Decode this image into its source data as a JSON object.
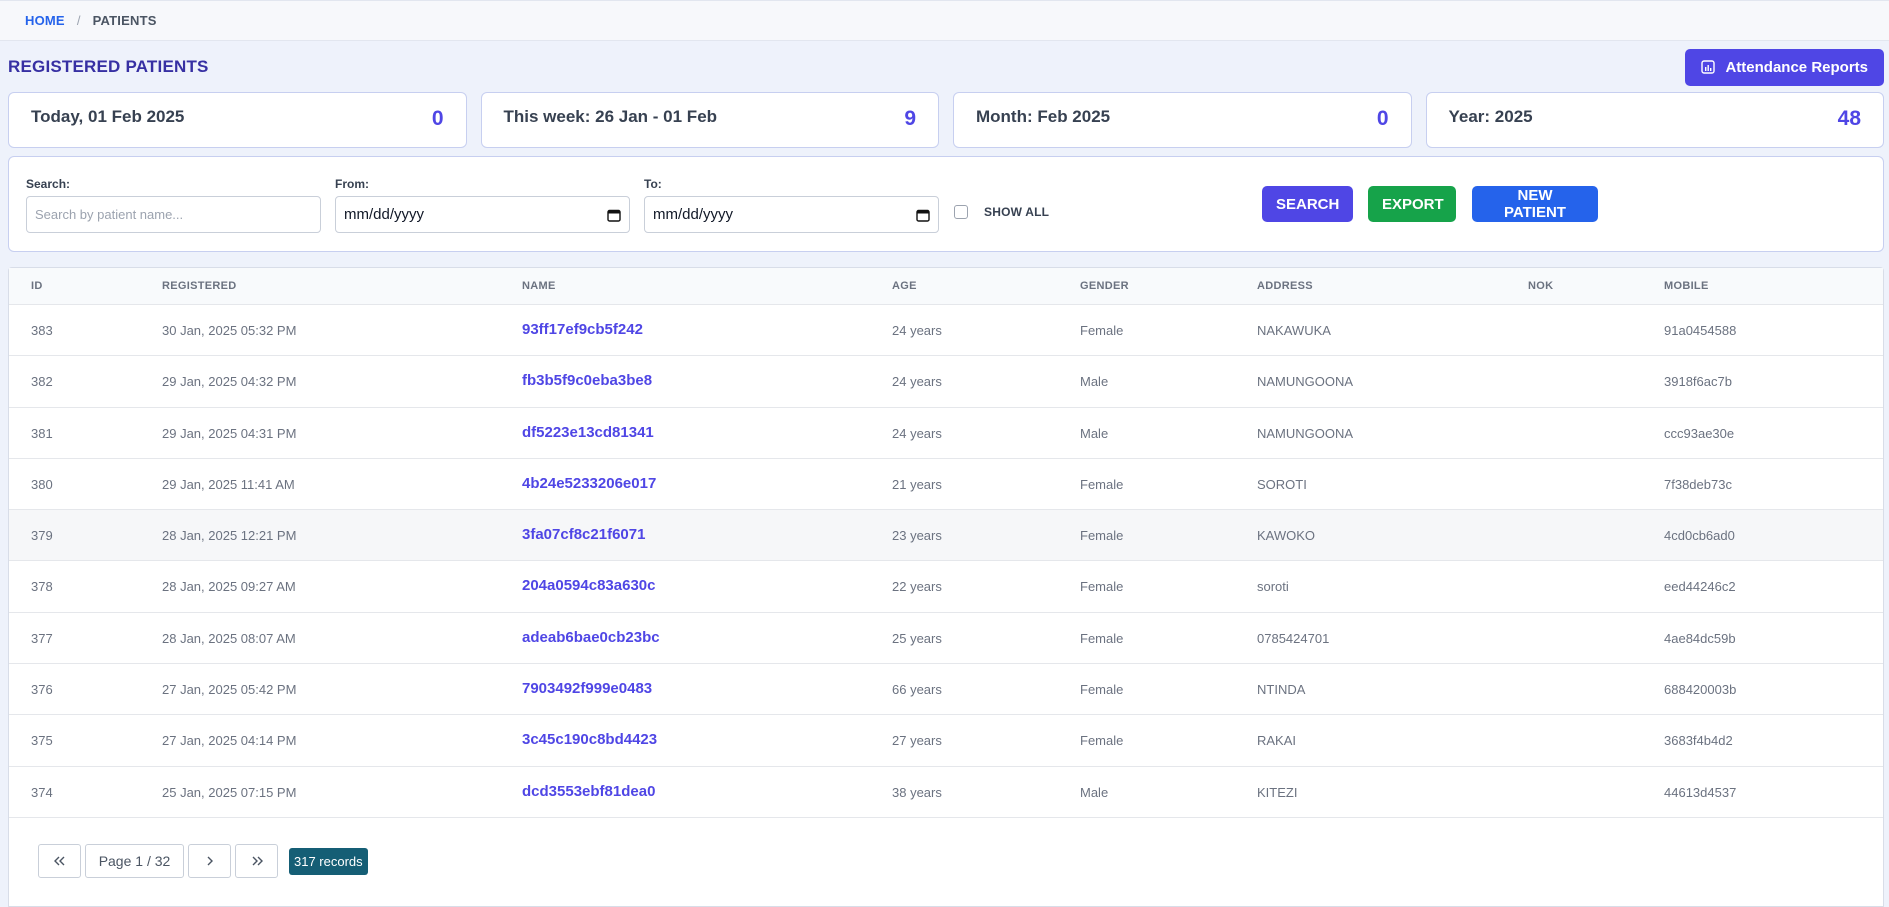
{
  "breadcrumb": {
    "home": "HOME",
    "separator": "/",
    "current": "PATIENTS"
  },
  "header": {
    "title": "REGISTERED PATIENTS",
    "attendance_button": "Attendance Reports"
  },
  "stats": [
    {
      "label": "Today, 01 Feb 2025",
      "value": "0"
    },
    {
      "label": "This week: 26 Jan - 01 Feb",
      "value": "9"
    },
    {
      "label": "Month: Feb 2025",
      "value": "0"
    },
    {
      "label": "Year: 2025",
      "value": "48"
    }
  ],
  "filters": {
    "search_label": "Search:",
    "search_placeholder": "Search by patient name...",
    "from_label": "From:",
    "from_value": "mm/dd/yyyy",
    "to_label": "To:",
    "to_value": "mm/dd/yyyy",
    "show_all_label": "SHOW ALL",
    "search_button": "SEARCH",
    "export_button": "EXPORT",
    "new_patient_button": "NEW PATIENT"
  },
  "table": {
    "columns": [
      "ID",
      "REGISTERED",
      "NAME",
      "AGE",
      "GENDER",
      "ADDRESS",
      "NOK",
      "MOBILE"
    ],
    "rows": [
      {
        "id": "383",
        "registered": "30 Jan, 2025 05:32 PM",
        "name": "93ff17ef9cb5f242",
        "age": "24 years",
        "gender": "Female",
        "address": "NAKAWUKA",
        "nok": "",
        "mobile": "91a0454588"
      },
      {
        "id": "382",
        "registered": "29 Jan, 2025 04:32 PM",
        "name": "fb3b5f9c0eba3be8",
        "age": "24 years",
        "gender": "Male",
        "address": "NAMUNGOONA",
        "nok": "",
        "mobile": "3918f6ac7b"
      },
      {
        "id": "381",
        "registered": "29 Jan, 2025 04:31 PM",
        "name": "df5223e13cd81341",
        "age": "24 years",
        "gender": "Male",
        "address": "NAMUNGOONA",
        "nok": "",
        "mobile": "ccc93ae30e"
      },
      {
        "id": "380",
        "registered": "29 Jan, 2025 11:41 AM",
        "name": "4b24e5233206e017",
        "age": "21 years",
        "gender": "Female",
        "address": "SOROTI",
        "nok": "",
        "mobile": "7f38deb73c"
      },
      {
        "id": "379",
        "registered": "28 Jan, 2025 12:21 PM",
        "name": "3fa07cf8c21f6071",
        "age": "23 years",
        "gender": "Female",
        "address": "KAWOKO",
        "nok": "",
        "mobile": "4cd0cb6ad0"
      },
      {
        "id": "378",
        "registered": "28 Jan, 2025 09:27 AM",
        "name": "204a0594c83a630c",
        "age": "22 years",
        "gender": "Female",
        "address": "soroti",
        "nok": "",
        "mobile": "eed44246c2"
      },
      {
        "id": "377",
        "registered": "28 Jan, 2025 08:07 AM",
        "name": "adeab6bae0cb23bc",
        "age": "25 years",
        "gender": "Female",
        "address": "0785424701",
        "nok": "",
        "mobile": "4ae84dc59b"
      },
      {
        "id": "376",
        "registered": "27 Jan, 2025 05:42 PM",
        "name": "7903492f999e0483",
        "age": "66 years",
        "gender": "Female",
        "address": "NTINDA",
        "nok": "",
        "mobile": "688420003b"
      },
      {
        "id": "375",
        "registered": "27 Jan, 2025 04:14 PM",
        "name": "3c45c190c8bd4423",
        "age": "27 years",
        "gender": "Female",
        "address": "RAKAI",
        "nok": "",
        "mobile": "3683f4b4d2"
      },
      {
        "id": "374",
        "registered": "25 Jan, 2025 07:15 PM",
        "name": "dcd3553ebf81dea0",
        "age": "38 years",
        "gender": "Male",
        "address": "KITEZI",
        "nok": "",
        "mobile": "44613d4537"
      }
    ]
  },
  "pagination": {
    "first": "«",
    "prev": "‹",
    "page": "Page 1 / 32",
    "next": "›",
    "last": "»",
    "records": "317 records"
  }
}
